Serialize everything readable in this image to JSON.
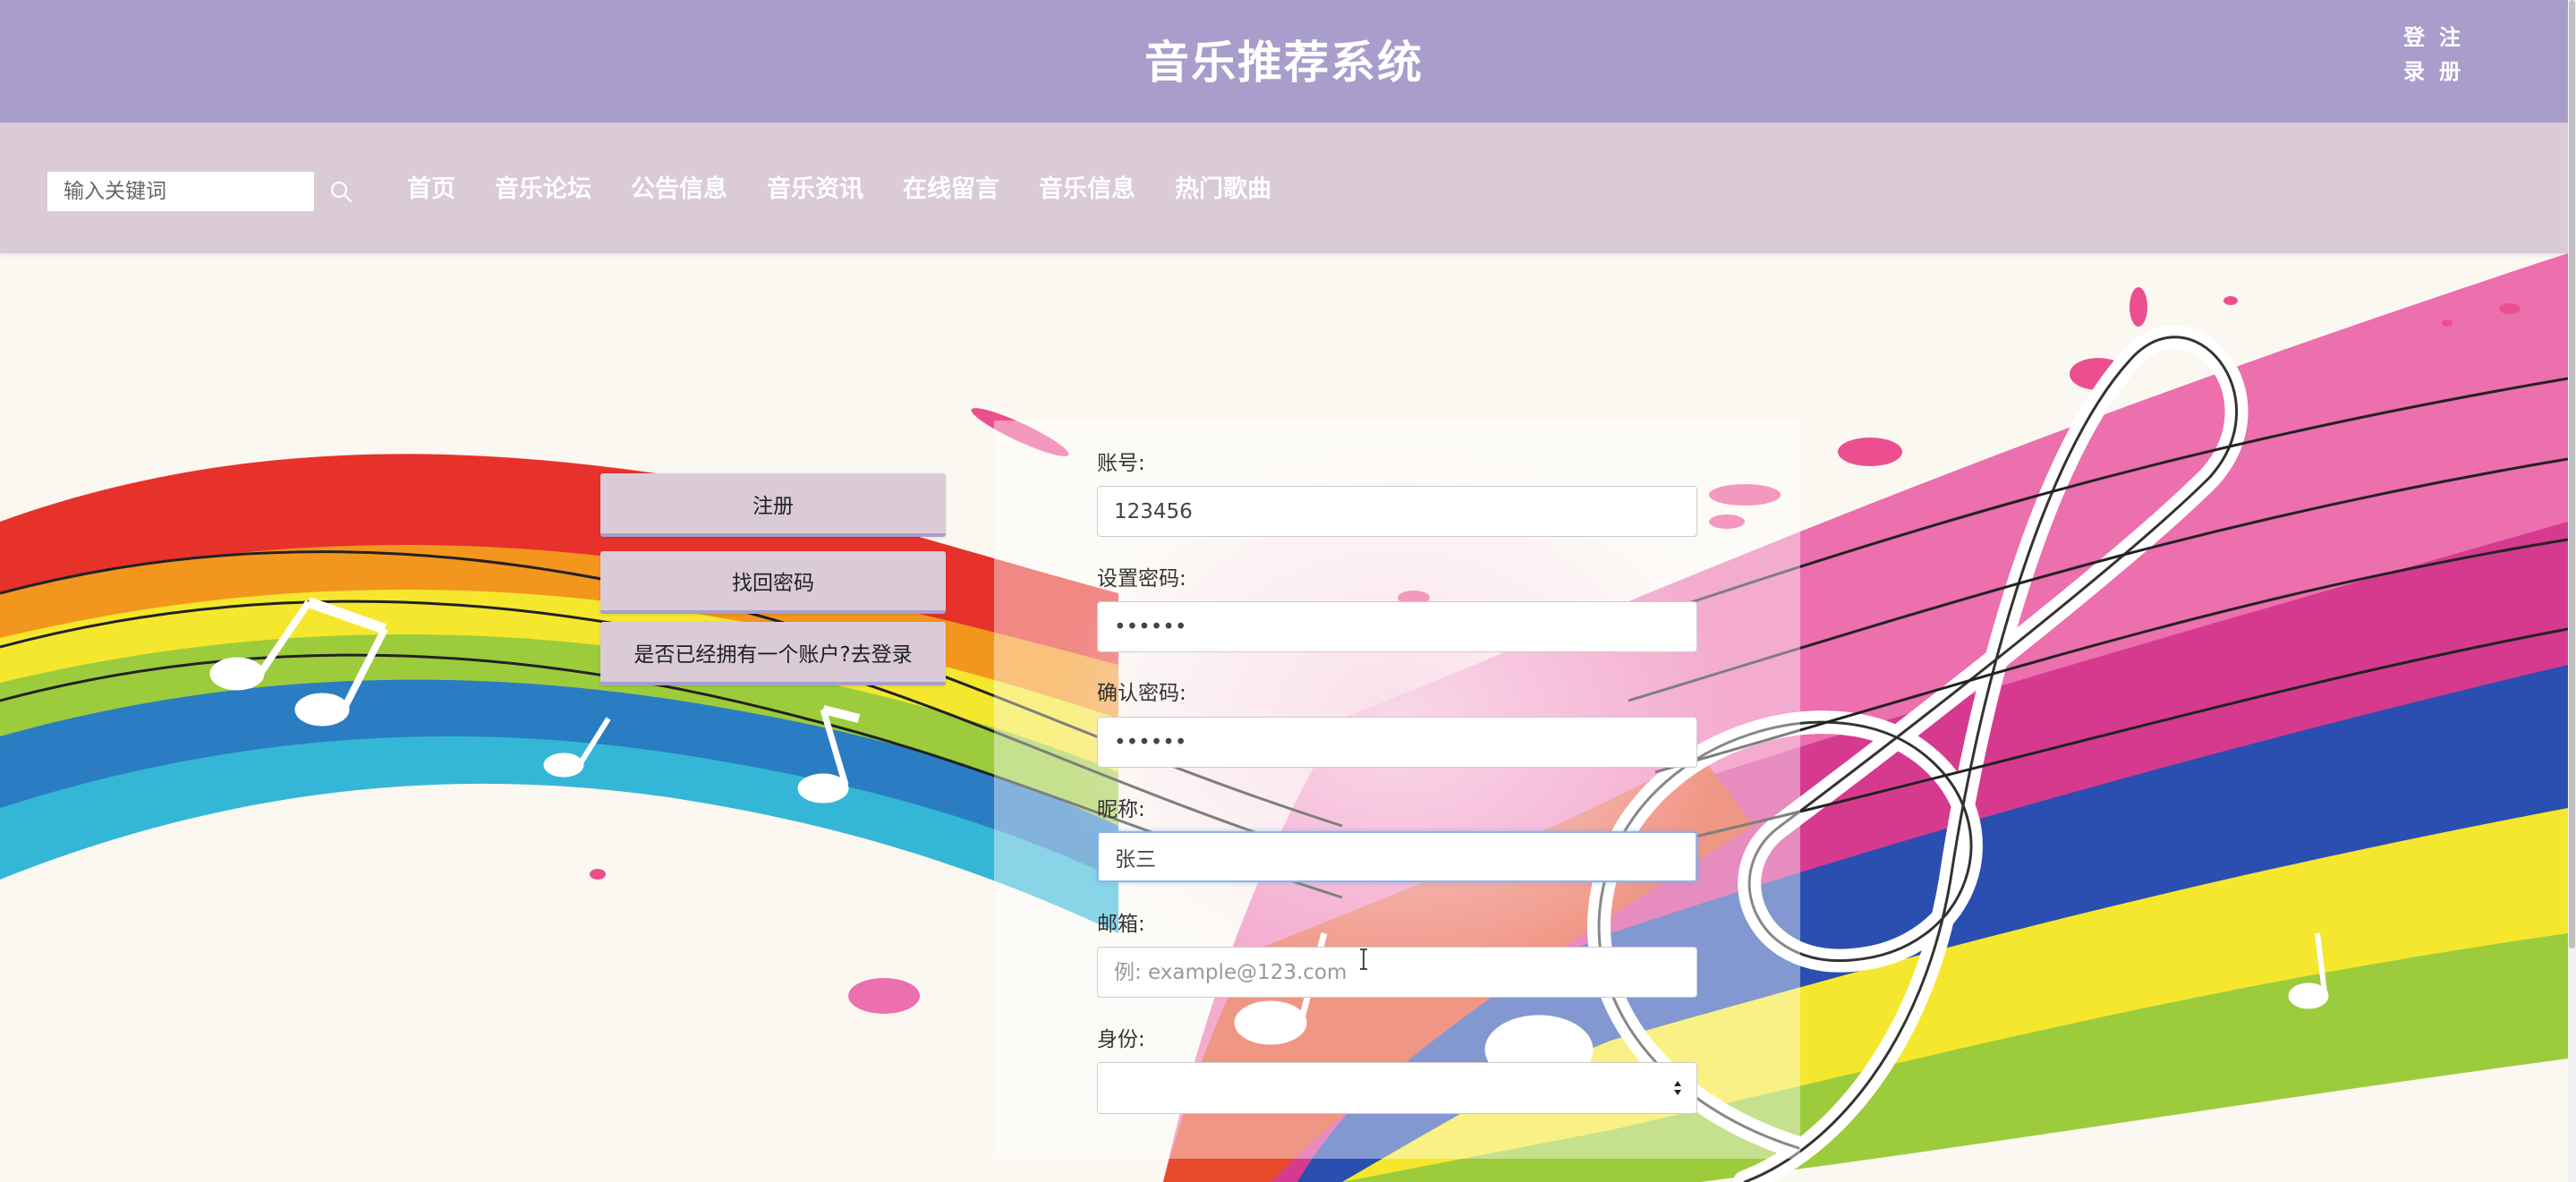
{
  "header": {
    "title": "音乐推荐系统",
    "login_label_top": "登",
    "login_label_bottom": "录",
    "register_label_top": "注",
    "register_label_bottom": "册"
  },
  "navbar": {
    "search_placeholder": "输入关键词",
    "items": [
      "首页",
      "音乐论坛",
      "公告信息",
      "音乐资讯",
      "在线留言",
      "音乐信息",
      "热门歌曲"
    ]
  },
  "side_buttons": {
    "register": "注册",
    "find_password": "找回密码",
    "go_login": "是否已经拥有一个账户?去登录"
  },
  "form": {
    "account_label": "账号:",
    "account_value": "123456",
    "password_label": "设置密码:",
    "password_value": "••••••",
    "confirm_label": "确认密码:",
    "confirm_value": "••••••",
    "nickname_label": "昵称:",
    "nickname_value": "张三",
    "email_label": "邮箱:",
    "email_placeholder": "例: example@123.com",
    "role_label": "身份:",
    "role_value": ""
  },
  "colors": {
    "header_bg": "#a99ecb",
    "navbar_bg": "#dacbd7",
    "button_bg": "#dacbd7",
    "focus_border": "#8fb4e8"
  },
  "icons": {
    "search": "search-icon",
    "select_arrows": "updown-arrows-icon",
    "cursor": "text-cursor-icon"
  }
}
